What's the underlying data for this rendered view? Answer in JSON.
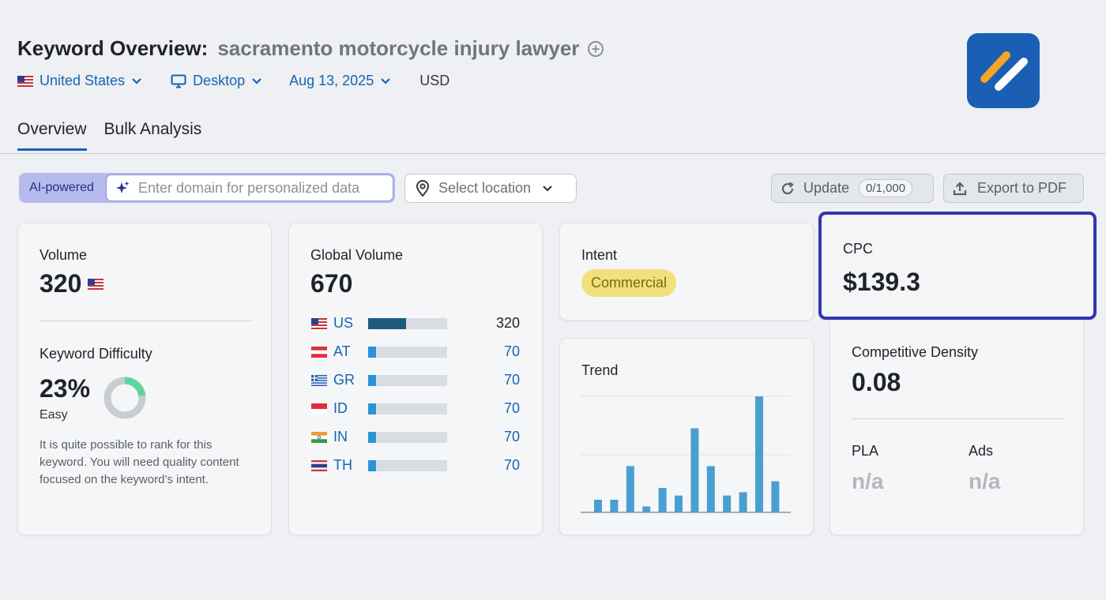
{
  "header": {
    "title": "Keyword Overview:",
    "keyword": "sacramento motorcycle injury lawyer"
  },
  "filters": {
    "country": "United States",
    "device": "Desktop",
    "date": "Aug 13, 2025",
    "currency": "USD"
  },
  "tabs": [
    {
      "label": "Overview",
      "active": true
    },
    {
      "label": "Bulk Analysis",
      "active": false
    }
  ],
  "toolbar": {
    "ai_label": "AI-powered",
    "domain_placeholder": "Enter domain for personalized data",
    "location_placeholder": "Select location",
    "update_label": "Update",
    "update_counter": "0/1,000",
    "export_label": "Export to PDF"
  },
  "volume": {
    "label": "Volume",
    "value": "320"
  },
  "keyword_difficulty": {
    "label": "Keyword Difficulty",
    "value": "23%",
    "rating": "Easy",
    "percent": 23,
    "description": "It is quite possible to rank for this keyword. You will need quality content focused on the keyword’s intent."
  },
  "global_volume": {
    "label": "Global Volume",
    "value": "670",
    "countries": [
      {
        "code": "US",
        "value": "320",
        "share": 0.48
      },
      {
        "code": "AT",
        "value": "70",
        "share": 0.1
      },
      {
        "code": "GR",
        "value": "70",
        "share": 0.1
      },
      {
        "code": "ID",
        "value": "70",
        "share": 0.1
      },
      {
        "code": "IN",
        "value": "70",
        "share": 0.1
      },
      {
        "code": "TH",
        "value": "70",
        "share": 0.1
      }
    ]
  },
  "intent": {
    "label": "Intent",
    "value": "Commercial"
  },
  "trend": {
    "label": "Trend",
    "values": [
      0.15,
      0.15,
      0.55,
      0.07,
      0.29,
      0.2,
      1.0,
      0.55,
      0.2,
      0.24,
      1.38,
      0.37
    ]
  },
  "cpc": {
    "label": "CPC",
    "value": "$139.3"
  },
  "competitive_density": {
    "label": "Competitive Density",
    "value": "0.08",
    "pla_label": "PLA",
    "pla_value": "n/a",
    "ads_label": "Ads",
    "ads_value": "n/a"
  },
  "colors": {
    "accent": "#1763b6",
    "highlight": "#3336b0",
    "trend_bar": "#4a9fd0",
    "kd_green": "#5dd5a0",
    "intent_badge": "#f2e07a"
  }
}
